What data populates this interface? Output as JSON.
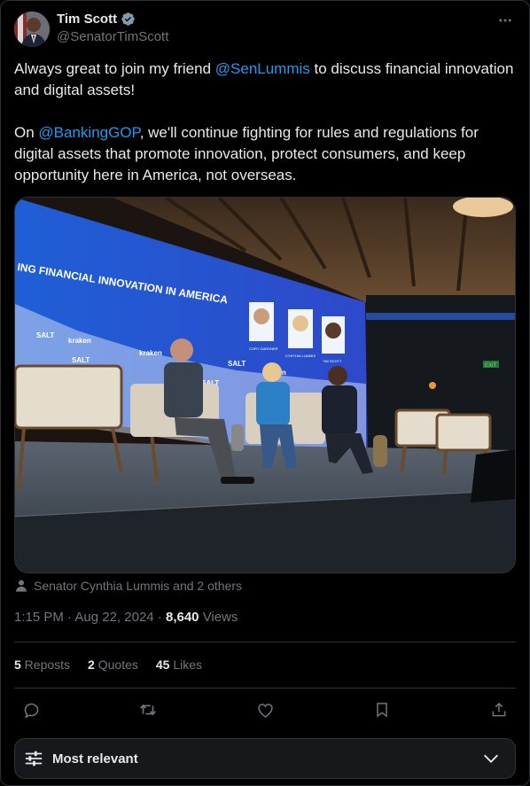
{
  "author": {
    "name": "Tim Scott",
    "handle": "@SenatorTimScott"
  },
  "tweet": {
    "p1_before": "Always great to join my friend ",
    "p1_mention": "@SenLummis",
    "p1_after": " to discuss financial innovation and digital assets!",
    "p2_before": "On ",
    "p2_mention": "@BankingGOP",
    "p2_after": ", we'll continue fighting for rules and regulations for digital assets that promote innovation, protect consumers, and keep opportunity here in America, not overseas."
  },
  "media": {
    "banner_text": "ING FINANCIAL INNOVATION IN AMERICA",
    "speaker_labels": [
      "CORY GARDNER",
      "CYNTHIA LUMMIS",
      "TIM SCOTT"
    ],
    "sponsor_words": [
      "SALT",
      "kraken"
    ],
    "exit_sign": "EXIT"
  },
  "tagged": "Senator Cynthia Lummis and 2 others",
  "meta": {
    "time": "1:15 PM",
    "sep1": " · ",
    "date": "Aug 22, 2024",
    "sep2": " · ",
    "views_count": "8,640",
    "views_label": " Views"
  },
  "stats": {
    "reposts_count": "5",
    "reposts_label": " Reposts",
    "quotes_count": "2",
    "quotes_label": " Quotes",
    "likes_count": "45",
    "likes_label": " Likes"
  },
  "sort": {
    "label": "Most relevant"
  },
  "colors": {
    "accent": "#1d9bf0",
    "text": "#e7e9ea",
    "muted": "#71767b",
    "border": "#2f3336"
  }
}
